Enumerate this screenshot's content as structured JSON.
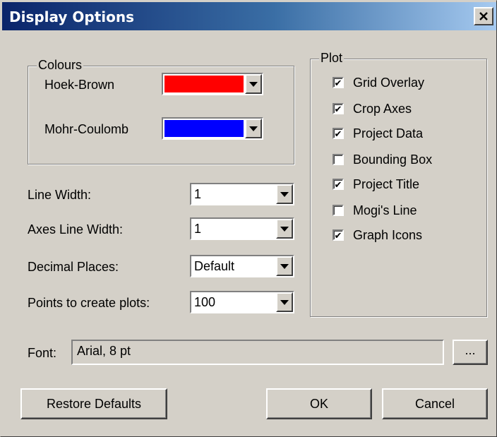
{
  "window": {
    "title": "Display Options",
    "close_glyph": "✕"
  },
  "colours": {
    "legend": "Colours",
    "hoek_brown": {
      "label": "Hoek-Brown",
      "color": "#ff0000"
    },
    "mohr_coulomb": {
      "label": "Mohr-Coulomb",
      "color": "#0000ff"
    }
  },
  "settings": {
    "line_width": {
      "label": "Line Width:",
      "value": "1"
    },
    "axes_line_width": {
      "label": "Axes Line Width:",
      "value": "1"
    },
    "decimal_places": {
      "label": "Decimal Places:",
      "value": "Default"
    },
    "points_to_create_plots": {
      "label": "Points to create plots:",
      "value": "100"
    }
  },
  "plot": {
    "legend": "Plot",
    "options": [
      {
        "label": "Grid Overlay",
        "checked": true
      },
      {
        "label": "Crop Axes",
        "checked": true
      },
      {
        "label": "Project Data",
        "checked": true
      },
      {
        "label": "Bounding Box",
        "checked": false
      },
      {
        "label": "Project Title",
        "checked": true
      },
      {
        "label": "Mogi's Line",
        "checked": false
      },
      {
        "label": "Graph Icons",
        "checked": true
      }
    ]
  },
  "font": {
    "label": "Font:",
    "value": "Arial, 8 pt",
    "browse_label": "..."
  },
  "buttons": {
    "restore": "Restore Defaults",
    "ok": "OK",
    "cancel": "Cancel"
  }
}
